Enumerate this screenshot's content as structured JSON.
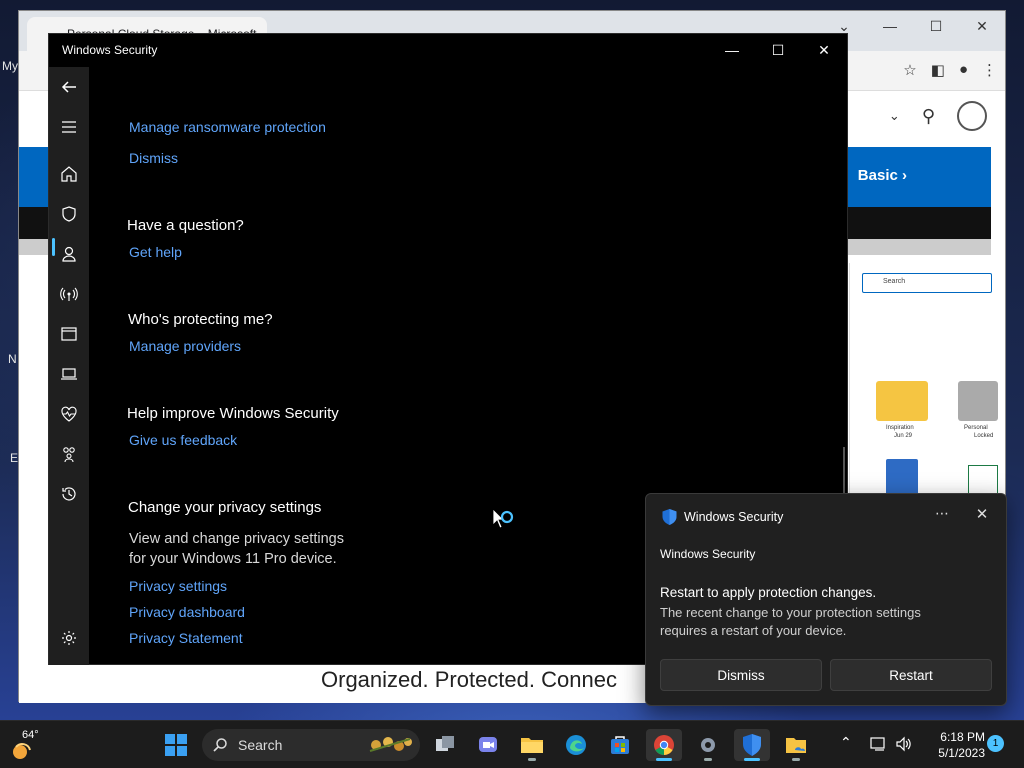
{
  "desktop": {
    "fragments": [
      "My",
      "N",
      "E"
    ]
  },
  "browser": {
    "tab_title": "Personal Cloud Storage – Microsoft",
    "banner_link": "Basic",
    "mock_search_placeholder": "Search",
    "mock_folder_caption": "Inspiration",
    "mock_folder_date": "Jun 29",
    "mock_vault_caption": "Personal",
    "mock_vault_sub": "Locked",
    "tagline": "Organized. Protected. Connec"
  },
  "ws": {
    "title": "Windows Security",
    "links": {
      "ransomware": "Manage ransomware protection",
      "dismiss": "Dismiss",
      "get_help": "Get help",
      "manage_providers": "Manage providers",
      "feedback": "Give us feedback",
      "privacy_settings": "Privacy settings",
      "privacy_dashboard": "Privacy dashboard",
      "privacy_statement": "Privacy Statement"
    },
    "headings": {
      "question": "Have a question?",
      "protecting": "Who's protecting me?",
      "improve": "Help improve Windows Security",
      "privacy": "Change your privacy settings"
    },
    "privacy_body_line1": "View and change privacy settings",
    "privacy_body_line2": "for your Windows 11 Pro device.",
    "sidebar_icons": [
      "back-icon",
      "menu-icon",
      "home-icon",
      "shield-icon",
      "account-icon",
      "wifi-icon",
      "app-browser-icon",
      "device-icon",
      "health-icon",
      "family-icon",
      "history-icon",
      "settings-icon"
    ]
  },
  "toast": {
    "app_name": "Windows Security",
    "sender": "Windows Security",
    "title": "Restart to apply protection changes.",
    "body_line1": "The recent change to your protection settings",
    "body_line2": "requires a restart of your device.",
    "dismiss": "Dismiss",
    "restart": "Restart"
  },
  "taskbar": {
    "temperature": "64°",
    "search_label": "Search",
    "time": "6:18 PM",
    "date": "5/1/2023",
    "notification_count": "1",
    "accent": "#4cc2ff"
  }
}
